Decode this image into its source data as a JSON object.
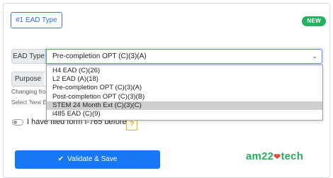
{
  "header": {
    "tag_label": "#1 EAD Type",
    "new_badge": "NEW"
  },
  "ead_type": {
    "label": "EAD Type",
    "selected_value": "Pre-completion OPT (C)(3)(A)",
    "options": [
      "H4 EAD (C)(26)",
      "L2 EAD (A)(18)",
      "Pre-completion OPT (C)(3)(A)",
      "Post-completion OPT (C)(3)(B)",
      "STEM 24 Month Ext (C)(3)(C)",
      "i485 EAD (C)(9)"
    ],
    "highlighted_index": 4
  },
  "purpose": {
    "label": "Purpose",
    "help_text_1": "Changing fro",
    "help_text_2": "Select 'New E"
  },
  "filed": {
    "label": "I have filed form I-765 before",
    "help_button": "?",
    "checked": false
  },
  "actions": {
    "validate_label": "Validate & Save"
  },
  "branding": {
    "logo_left": "am22",
    "logo_right": "tech",
    "brand_color": "#27ae60",
    "accent_color": "#1877f2",
    "heart_color": "#e74c3c"
  }
}
